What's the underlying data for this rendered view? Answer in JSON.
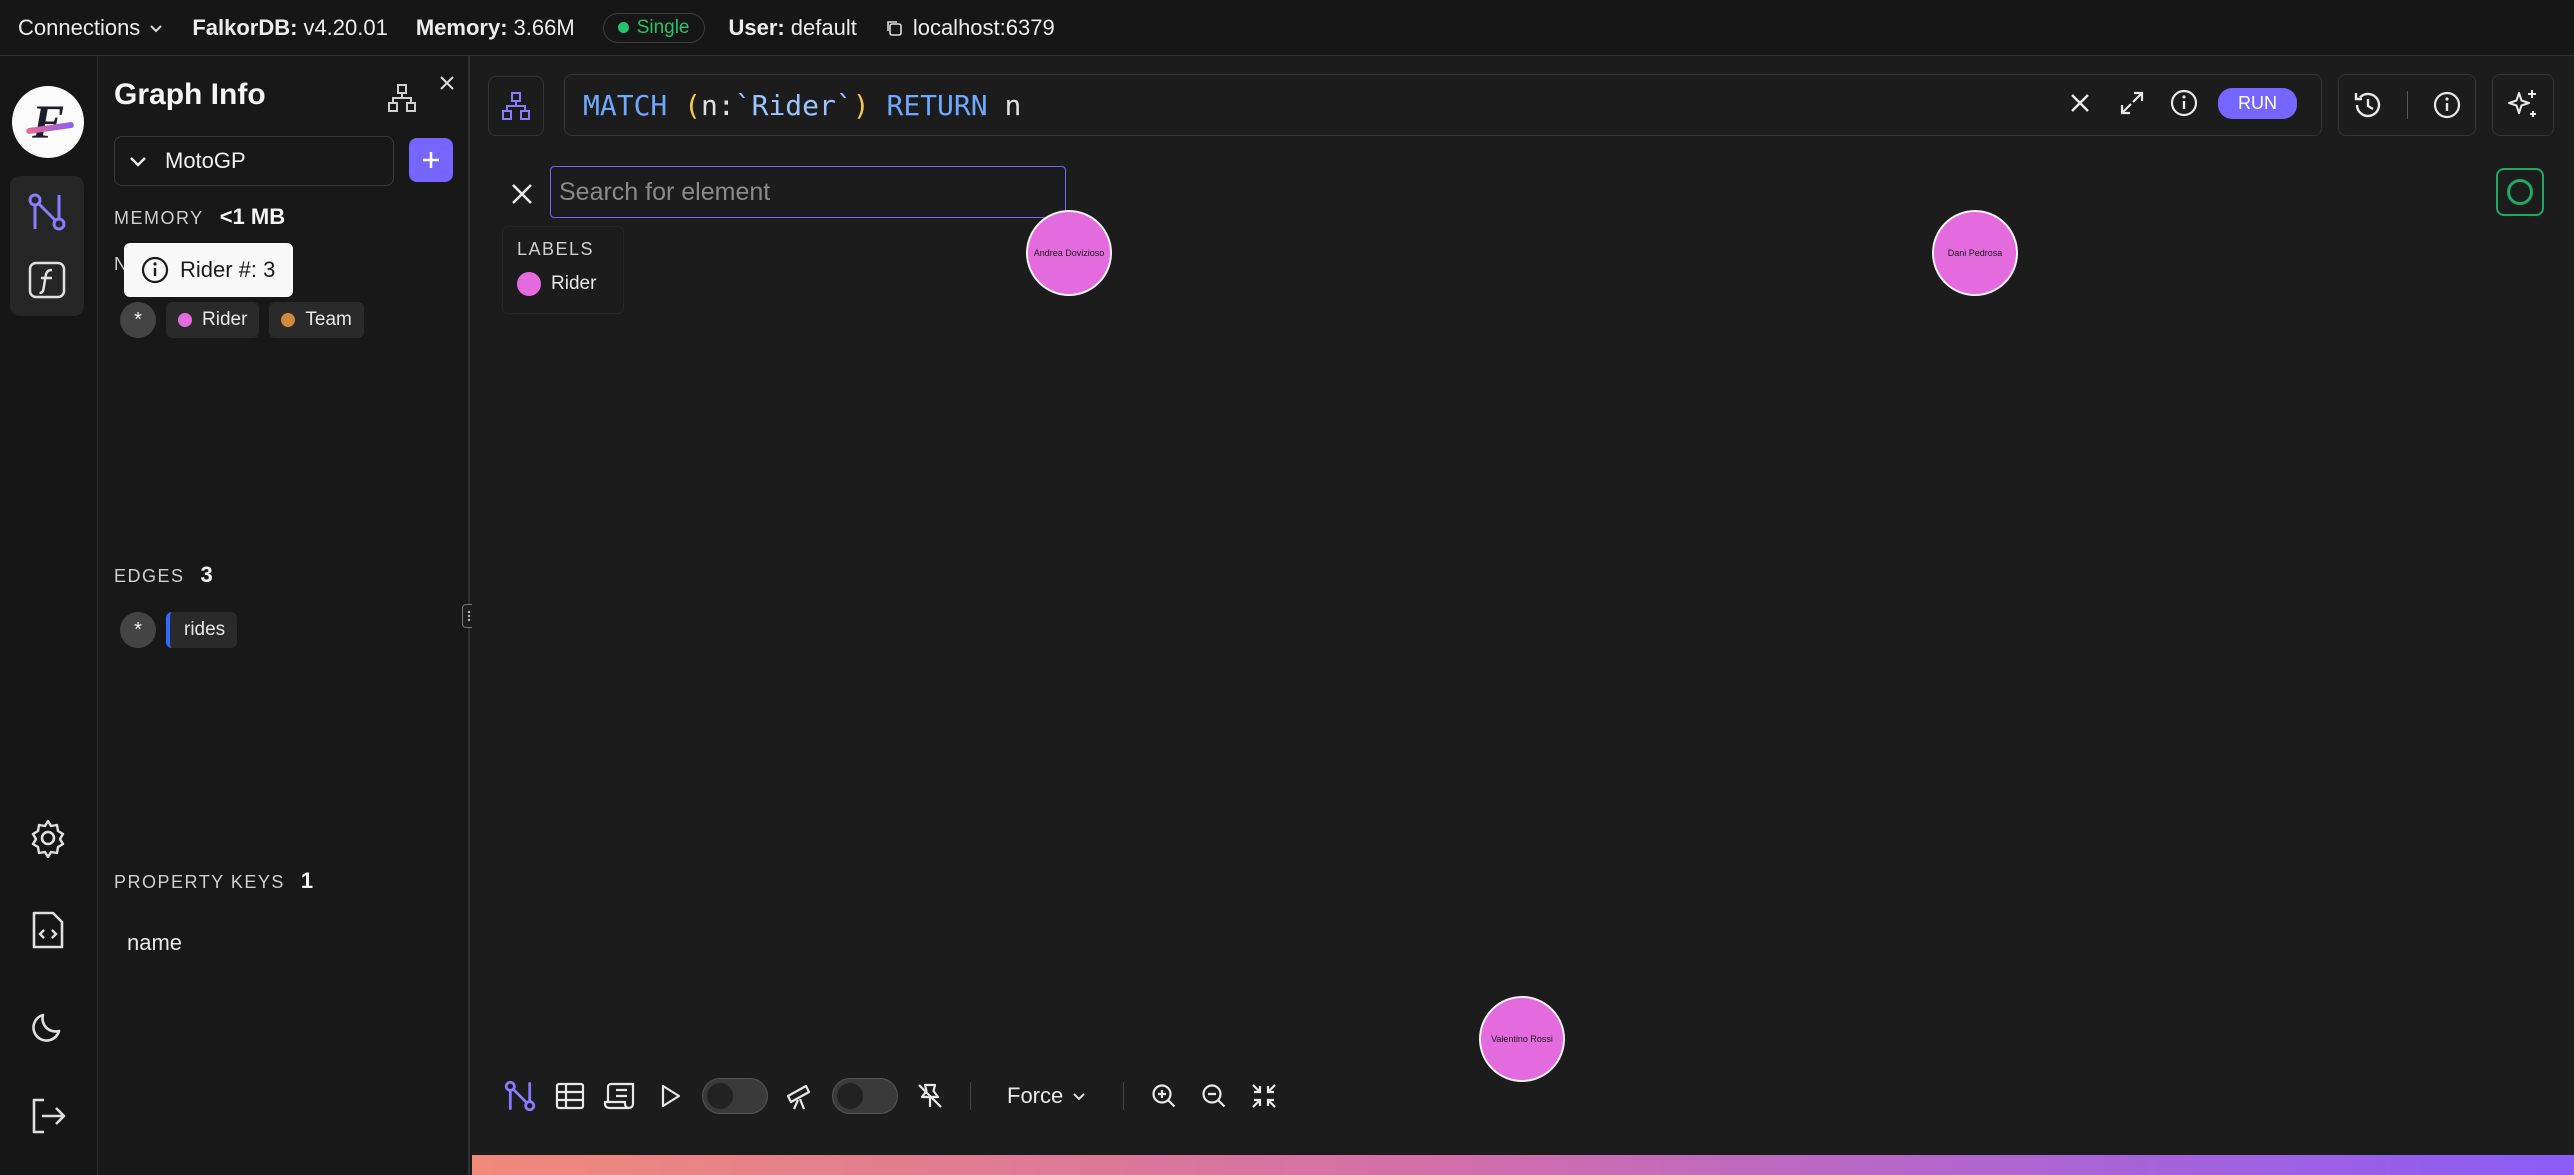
{
  "topbar": {
    "connections": "Connections",
    "db_label": "FalkorDB:",
    "db_version": "v4.20.01",
    "memory_label": "Memory:",
    "memory_value": "3.66M",
    "mode": "Single",
    "user_label": "User:",
    "user_value": "default",
    "host": "localhost:6379"
  },
  "panel": {
    "title": "Graph Info",
    "graph_name": "MotoGP",
    "memory": {
      "label": "MEMORY",
      "value": "<1 MB"
    },
    "nodes_label_partial": "N",
    "tooltip": "Rider #: 3",
    "labels": [
      {
        "name": "Rider",
        "color": "#e36bde"
      },
      {
        "name": "Team",
        "color": "#d08a3a"
      }
    ],
    "all_symbol": "*",
    "edges": {
      "label": "EDGES",
      "value": "3",
      "types": [
        "rides"
      ]
    },
    "property_keys": {
      "label": "PROPERTY KEYS",
      "value": "1",
      "keys": [
        "name"
      ]
    }
  },
  "query": {
    "kw1": "MATCH",
    "open": "(",
    "var": "n",
    "colon": ":",
    "label": "`Rider`",
    "close": ")",
    "kw2": "RETURN",
    "ret": "n",
    "run": "RUN"
  },
  "search": {
    "placeholder": "Search for element"
  },
  "legend": {
    "header": "LABELS",
    "items": [
      "Rider"
    ]
  },
  "nodes": [
    "Andrea Dovizioso",
    "Dani Pedrosa",
    "Valentino Rossi"
  ],
  "toolbar": {
    "layout": "Force"
  },
  "colors": {
    "accent": "#7466ff",
    "rider": "#e36bde",
    "team": "#d08a3a",
    "edge": "#2f6bff",
    "success": "#27c26c"
  }
}
